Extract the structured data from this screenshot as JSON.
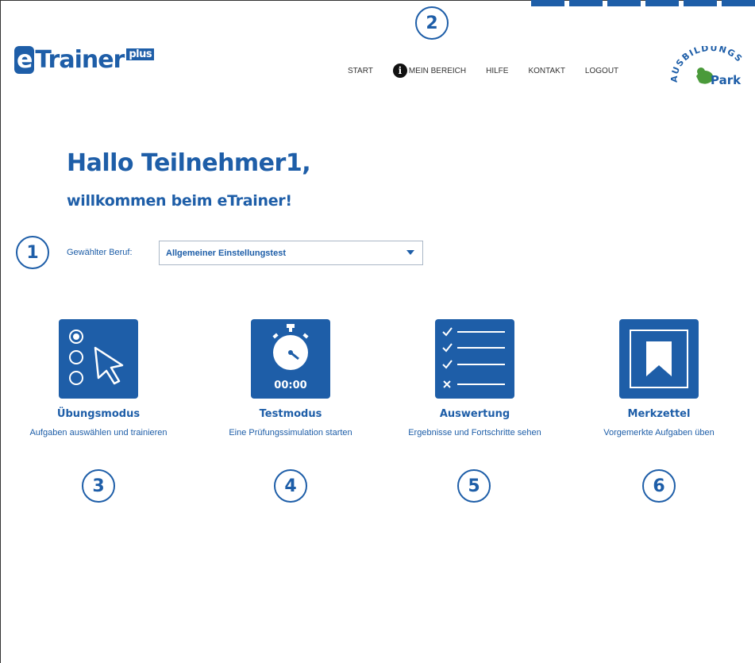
{
  "app": {
    "logo_main": "eTrainer",
    "logo_plus": "plus",
    "partner_logo_text": "AUSBILDUNGS",
    "partner_logo_sub": "Park"
  },
  "nav": {
    "start": "START",
    "mein_bereich": "MEIN BEREICH",
    "hilfe": "HILFE",
    "kontakt": "KONTAKT",
    "logout": "LOGOUT"
  },
  "greeting": {
    "title": "Hallo Teilnehmer1,",
    "subtitle": "willkommen beim eTrainer!"
  },
  "beruf": {
    "label": "Gewählter Beruf:",
    "selected": "Allgemeiner Einstellungstest"
  },
  "modules": [
    {
      "title": "Übungsmodus",
      "desc": "Aufgaben auswählen und trainieren",
      "icon": "radio-cursor-icon"
    },
    {
      "title": "Testmodus",
      "desc": "Eine Prüfungssimulation starten",
      "icon": "stopwatch-icon",
      "timer": "00:00"
    },
    {
      "title": "Auswertung",
      "desc": "Ergebnisse und Fortschritte sehen",
      "icon": "checklist-icon"
    },
    {
      "title": "Merkzettel",
      "desc": "Vorgemerkte Aufgaben üben",
      "icon": "bookmark-icon"
    }
  ],
  "callouts": [
    "1",
    "2",
    "3",
    "4",
    "5",
    "6"
  ],
  "colors": {
    "accent": "#1e5ea8",
    "partner_green": "#4a9a3a"
  }
}
